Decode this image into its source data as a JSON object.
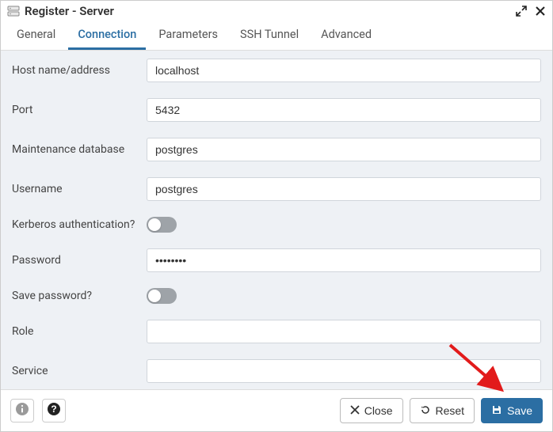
{
  "header": {
    "title": "Register - Server"
  },
  "tabs": [
    {
      "label": "General",
      "active": false
    },
    {
      "label": "Connection",
      "active": true
    },
    {
      "label": "Parameters",
      "active": false
    },
    {
      "label": "SSH Tunnel",
      "active": false
    },
    {
      "label": "Advanced",
      "active": false
    }
  ],
  "form": {
    "host_label": "Host name/address",
    "host_value": "localhost",
    "port_label": "Port",
    "port_value": "5432",
    "maintdb_label": "Maintenance database",
    "maintdb_value": "postgres",
    "username_label": "Username",
    "username_value": "postgres",
    "kerberos_label": "Kerberos authentication?",
    "kerberos_on": false,
    "password_label": "Password",
    "password_value": "••••••••",
    "savepw_label": "Save password?",
    "savepw_on": false,
    "role_label": "Role",
    "role_value": "",
    "service_label": "Service",
    "service_value": ""
  },
  "footer": {
    "close_label": "Close",
    "reset_label": "Reset",
    "save_label": "Save"
  },
  "colors": {
    "accent": "#2b6ea3",
    "panel_bg": "#eef1f5"
  }
}
